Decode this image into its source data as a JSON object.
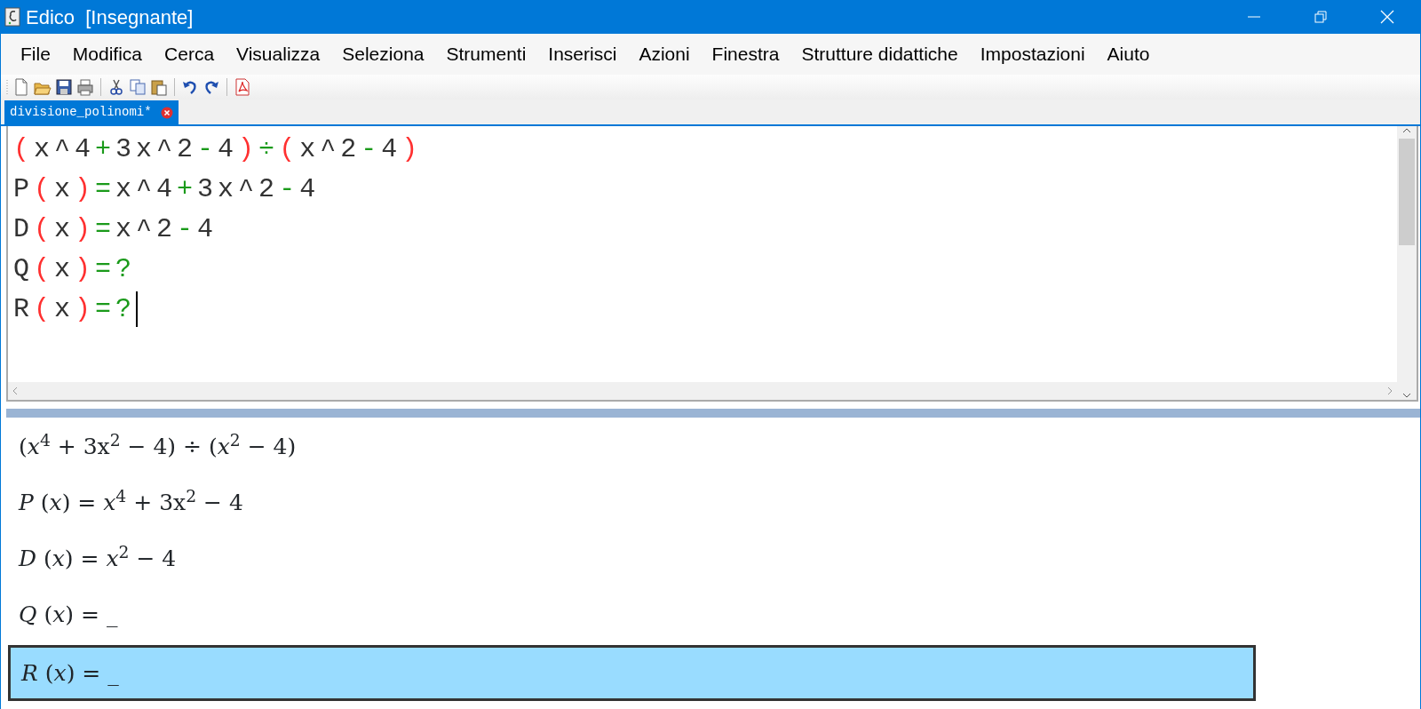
{
  "window": {
    "title": "Edico  [Insegnante]"
  },
  "menu": [
    "File",
    "Modifica",
    "Cerca",
    "Visualizza",
    "Seleziona",
    "Strumenti",
    "Inserisci",
    "Azioni",
    "Finestra",
    "Strutture didattiche",
    "Impostazioni",
    "Aiuto"
  ],
  "toolbar": [
    {
      "kind": "new"
    },
    {
      "kind": "open"
    },
    {
      "kind": "save"
    },
    {
      "kind": "print"
    },
    {
      "kind": "sep"
    },
    {
      "kind": "cut"
    },
    {
      "kind": "copy"
    },
    {
      "kind": "paste"
    },
    {
      "kind": "sep"
    },
    {
      "kind": "undo"
    },
    {
      "kind": "redo"
    },
    {
      "kind": "sep"
    },
    {
      "kind": "pdf"
    }
  ],
  "tabs": [
    {
      "label": "divisione_polinomi*",
      "selected": true
    }
  ],
  "editor": {
    "lines": [
      {
        "tokens": [
          {
            "text": "(",
            "kind": "paren"
          },
          {
            "text": "x^4",
            "kind": "plain"
          },
          {
            "text": "+",
            "kind": "op"
          },
          {
            "text": "3x^2",
            "kind": "plain"
          },
          {
            "text": "-",
            "kind": "op"
          },
          {
            "text": "4",
            "kind": "plain"
          },
          {
            "text": ")",
            "kind": "paren"
          },
          {
            "text": "÷",
            "kind": "op"
          },
          {
            "text": "(",
            "kind": "paren"
          },
          {
            "text": "x^2",
            "kind": "plain"
          },
          {
            "text": "-",
            "kind": "op"
          },
          {
            "text": "4",
            "kind": "plain"
          },
          {
            "text": ")",
            "kind": "paren"
          }
        ]
      },
      {
        "tokens": [
          {
            "text": "P",
            "kind": "plain"
          },
          {
            "text": "(",
            "kind": "paren"
          },
          {
            "text": "x",
            "kind": "plain"
          },
          {
            "text": ")",
            "kind": "paren"
          },
          {
            "text": "=",
            "kind": "op"
          },
          {
            "text": "x^4",
            "kind": "plain"
          },
          {
            "text": "+",
            "kind": "op"
          },
          {
            "text": "3x^2",
            "kind": "plain"
          },
          {
            "text": "-",
            "kind": "op"
          },
          {
            "text": "4",
            "kind": "plain"
          }
        ]
      },
      {
        "tokens": [
          {
            "text": "D",
            "kind": "plain"
          },
          {
            "text": "(",
            "kind": "paren"
          },
          {
            "text": "x",
            "kind": "plain"
          },
          {
            "text": ")",
            "kind": "paren"
          },
          {
            "text": "=",
            "kind": "op"
          },
          {
            "text": "x^2",
            "kind": "plain"
          },
          {
            "text": "-",
            "kind": "op"
          },
          {
            "text": "4",
            "kind": "plain"
          }
        ]
      },
      {
        "tokens": [
          {
            "text": "Q",
            "kind": "plain"
          },
          {
            "text": "(",
            "kind": "paren"
          },
          {
            "text": "x",
            "kind": "plain"
          },
          {
            "text": ")",
            "kind": "paren"
          },
          {
            "text": "=",
            "kind": "op"
          },
          {
            "text": "?",
            "kind": "op"
          }
        ]
      },
      {
        "tokens": [
          {
            "text": "R",
            "kind": "plain"
          },
          {
            "text": "(",
            "kind": "paren"
          },
          {
            "text": "x",
            "kind": "plain"
          },
          {
            "text": ")",
            "kind": "paren"
          },
          {
            "text": "=",
            "kind": "op"
          },
          {
            "text": "?",
            "kind": "op"
          }
        ],
        "cursor": true
      }
    ]
  },
  "preview": {
    "lines": [
      {
        "text": "(*x*$^{4}$ + 3x$^{2}$ − 4) ÷ (*x*$^{2}$ − 4)",
        "selected": false
      },
      {
        "text": "*P* (*x*) = *x*$^{4}$ + 3x$^{2}$ − 4",
        "selected": false
      },
      {
        "text": "*D* (*x*) = *x*$^{2}$ − 4",
        "selected": false
      },
      {
        "text": "*Q* (*x*) = _",
        "selected": false
      },
      {
        "text": "*R* (*x*) = _",
        "selected": true
      }
    ]
  }
}
